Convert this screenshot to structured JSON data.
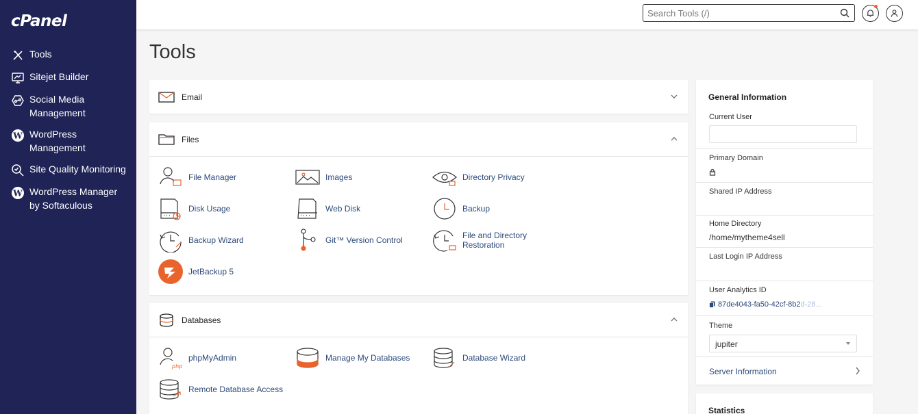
{
  "app": {
    "logo": "cPanel"
  },
  "sidebar": {
    "items": [
      {
        "label": "Tools",
        "icon": "tools-icon"
      },
      {
        "label": "Sitejet Builder",
        "icon": "sitejet-icon"
      },
      {
        "label": "Social Media Management",
        "icon": "social-media-icon"
      },
      {
        "label": "WordPress Management",
        "icon": "wordpress-icon"
      },
      {
        "label": "Site Quality Monitoring",
        "icon": "site-quality-icon"
      },
      {
        "label": "WordPress Manager by Softaculous",
        "icon": "wordpress-icon"
      }
    ]
  },
  "topbar": {
    "search_placeholder": "Search Tools (/)",
    "notification_color": "#e8642c"
  },
  "page": {
    "title": "Tools"
  },
  "sections": {
    "email": {
      "title": "Email",
      "expanded": false
    },
    "files": {
      "title": "Files",
      "expanded": true,
      "tools": [
        "File Manager",
        "Images",
        "Directory Privacy",
        "Disk Usage",
        "Web Disk",
        "Backup",
        "Backup Wizard",
        "Git™ Version Control",
        "File and Directory Restoration",
        "JetBackup 5"
      ]
    },
    "databases": {
      "title": "Databases",
      "expanded": true,
      "tools": [
        "phpMyAdmin",
        "Manage My Databases",
        "Database Wizard",
        "Remote Database Access"
      ]
    }
  },
  "general_info": {
    "title": "General Information",
    "current_user_label": "Current User",
    "current_user_value": "",
    "primary_domain_label": "Primary Domain",
    "shared_ip_label": "Shared IP Address",
    "home_dir_label": "Home Directory",
    "home_dir_value": "/home/mytheme4sell",
    "last_login_label": "Last Login IP Address",
    "analytics_label": "User Analytics ID",
    "analytics_value": "87de4043-fa50-42cf-8b2",
    "analytics_value_faded": "d-28...",
    "theme_label": "Theme",
    "theme_value": "jupiter",
    "server_info_label": "Server Information"
  },
  "statistics": {
    "title": "Statistics"
  },
  "colors": {
    "sidebar": "#1f2356",
    "accent": "#e8642c",
    "link": "#2d4a7a"
  }
}
